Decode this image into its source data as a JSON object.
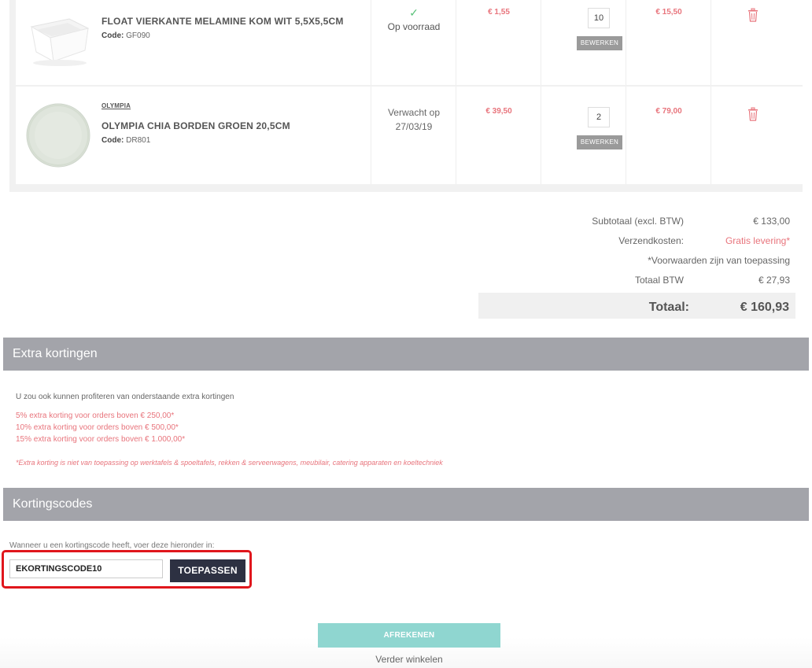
{
  "cart": {
    "items": [
      {
        "brand": "",
        "name": "FLOAT VIERKANTE MELAMINE KOM WIT 5,5X5,5CM",
        "code_label": "Code:",
        "code": "GF090",
        "stock_icon": "check-icon",
        "stock": "Op voorraad",
        "price": "€ 1,55",
        "qty": "10",
        "edit_label": "BEWERKEN",
        "total": "€ 15,50"
      },
      {
        "brand": "OLYMPIA",
        "name": "OLYMPIA CHIA BORDEN GROEN 20,5CM",
        "code_label": "Code:",
        "code": "DR801",
        "stock_line1": "Verwacht op",
        "stock_line2": "27/03/19",
        "price": "€ 39,50",
        "qty": "2",
        "edit_label": "BEWERKEN",
        "total": "€ 79,00"
      }
    ]
  },
  "summary": {
    "subtotal_label": "Subtotaal (excl. BTW)",
    "subtotal": "€ 133,00",
    "shipping_label": "Verzendkosten:",
    "shipping": "Gratis levering*",
    "conditions": "*Voorwaarden zijn van toepassing",
    "vat_label": "Totaal BTW",
    "vat": "€ 27,93",
    "total_label": "Totaal:",
    "total": "€ 160,93"
  },
  "extra": {
    "title": "Extra kortingen",
    "intro": "U zou ook kunnen profiteren van onderstaande extra kortingen",
    "tiers": [
      "5% extra korting voor orders boven € 250,00*",
      "10% extra korting voor orders boven € 500,00*",
      "15% extra korting voor orders boven € 1.000,00*"
    ],
    "note": "*Extra korting is niet van toepassing op werktafels & spoeltafels, rekken & serveerwagens, meubilair, catering apparaten en koeltechniek"
  },
  "coupon": {
    "title": "Kortingscodes",
    "intro": "Wanneer u een kortingscode heeft, voer deze hieronder in:",
    "value": "EKORTINGSCODE10",
    "apply_label": "TOEPASSEN"
  },
  "checkout": {
    "button_label": "AFREKENEN",
    "continue_label": "Verder winkelen"
  },
  "colors": {
    "accent_red": "#e8747c",
    "header_gray": "#a3a4aa",
    "checkout_teal": "#8fd6d0",
    "apply_navy": "#2d3142",
    "highlight_red": "#e0161c"
  }
}
